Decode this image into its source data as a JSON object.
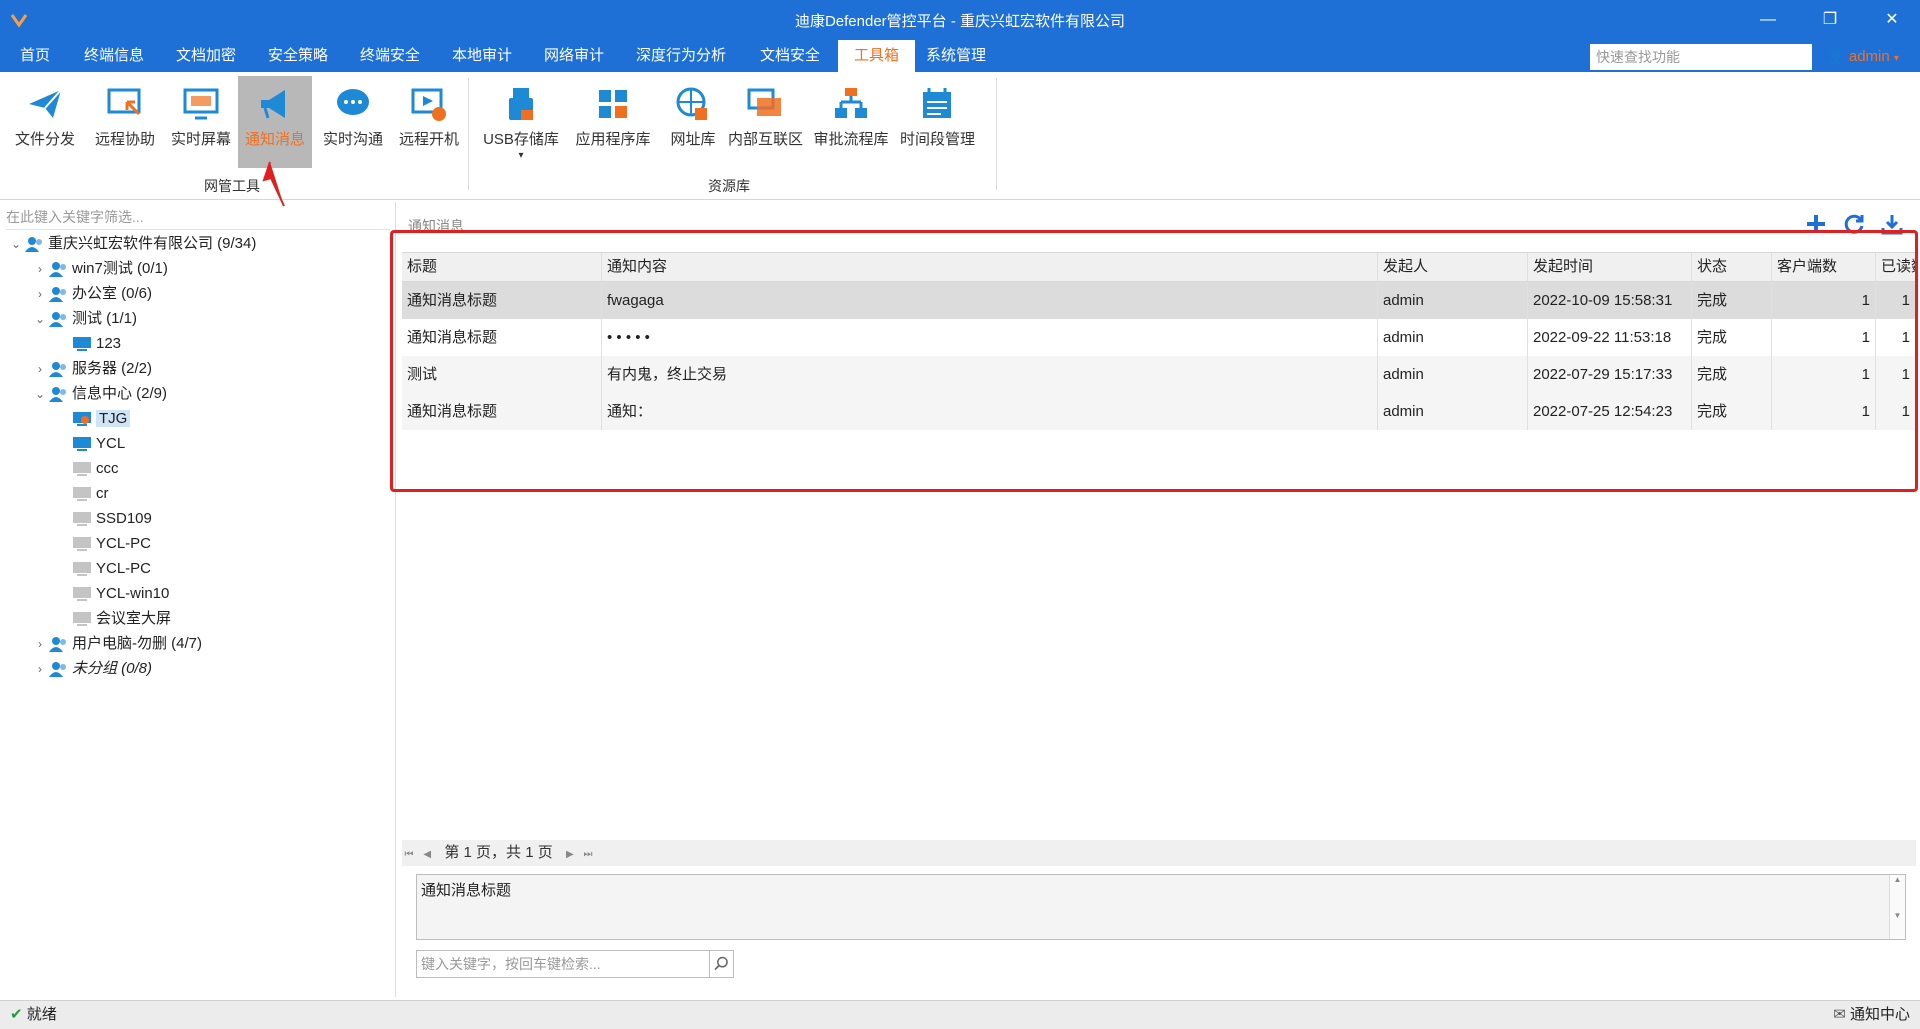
{
  "window": {
    "title": "迪康Defender管控平台 - 重庆兴虹宏软件有限公司"
  },
  "menu": {
    "items": [
      {
        "label": "首页"
      },
      {
        "label": "终端信息"
      },
      {
        "label": "文档加密"
      },
      {
        "label": "安全策略"
      },
      {
        "label": "终端安全"
      },
      {
        "label": "本地审计"
      },
      {
        "label": "网络审计"
      },
      {
        "label": "深度行为分析"
      },
      {
        "label": "文档安全"
      },
      {
        "label": "工具箱",
        "active": true
      },
      {
        "label": "系统管理"
      }
    ],
    "quick_search_placeholder": "快速查找功能",
    "user": "admin"
  },
  "ribbon": {
    "groups": [
      {
        "label": "网管工具",
        "tools": [
          {
            "label": "文件分发",
            "icon": "paper-plane-icon"
          },
          {
            "label": "远程协助",
            "icon": "remote-assist-icon"
          },
          {
            "label": "实时屏幕",
            "icon": "monitor-icon"
          },
          {
            "label": "通知消息",
            "icon": "megaphone-icon",
            "active": true
          },
          {
            "label": "实时沟通",
            "icon": "chat-bubble-icon"
          },
          {
            "label": "远程开机",
            "icon": "remote-power-icon"
          }
        ]
      },
      {
        "label": "资源库",
        "tools": [
          {
            "label": "USB存储库",
            "icon": "usb-icon",
            "dropdown": "▾"
          },
          {
            "label": "应用程序库",
            "icon": "app-grid-icon"
          },
          {
            "label": "网址库",
            "icon": "globe-icon"
          },
          {
            "label": "内部互联区",
            "icon": "network-icon"
          },
          {
            "label": "审批流程库",
            "icon": "flow-icon"
          },
          {
            "label": "时间段管理",
            "icon": "calendar-icon"
          }
        ]
      }
    ]
  },
  "tree": {
    "filter_placeholder": "在此键入关键字筛选...",
    "nodes": [
      {
        "label": "重庆兴虹宏软件有限公司 (9/34)",
        "level": 0,
        "chev": "⌄",
        "type": "group"
      },
      {
        "label": "win7测试 (0/1)",
        "level": 1,
        "chev": "›",
        "type": "group"
      },
      {
        "label": "办公室 (0/6)",
        "level": 1,
        "chev": "›",
        "type": "group"
      },
      {
        "label": "测试 (1/1)",
        "level": 1,
        "chev": "⌄",
        "type": "group"
      },
      {
        "label": "123",
        "level": 2,
        "chev": "",
        "type": "pc-online"
      },
      {
        "label": "服务器 (2/2)",
        "level": 1,
        "chev": "›",
        "type": "group"
      },
      {
        "label": "信息中心 (2/9)",
        "level": 1,
        "chev": "⌄",
        "type": "group"
      },
      {
        "label": "TJG",
        "level": 2,
        "chev": "",
        "type": "pc-self",
        "selected": true
      },
      {
        "label": "YCL",
        "level": 2,
        "chev": "",
        "type": "pc-online"
      },
      {
        "label": "ccc",
        "level": 2,
        "chev": "",
        "type": "pc-offline"
      },
      {
        "label": "cr",
        "level": 2,
        "chev": "",
        "type": "pc-offline"
      },
      {
        "label": "SSD109",
        "level": 2,
        "chev": "",
        "type": "pc-offline"
      },
      {
        "label": "YCL-PC",
        "level": 2,
        "chev": "",
        "type": "pc-offline"
      },
      {
        "label": "YCL-PC",
        "level": 2,
        "chev": "",
        "type": "pc-offline"
      },
      {
        "label": "YCL-win10",
        "level": 2,
        "chev": "",
        "type": "pc-offline"
      },
      {
        "label": "会议室大屏",
        "level": 2,
        "chev": "",
        "type": "pc-offline"
      },
      {
        "label": "用户电脑-勿删 (4/7)",
        "level": 1,
        "chev": "›",
        "type": "group"
      },
      {
        "label": "未分组 (0/8)",
        "level": 1,
        "chev": "›",
        "type": "group",
        "italic": true
      }
    ]
  },
  "notices": {
    "section_title": "通知消息",
    "columns": [
      "标题",
      "通知内容",
      "发起人",
      "发起时间",
      "状态",
      "客户端数",
      "已读数"
    ],
    "rows": [
      [
        "通知消息标题",
        "fwagaga",
        "admin",
        "2022-10-09 15:58:31",
        "完成",
        "1",
        "1"
      ],
      [
        "通知消息标题",
        "• • • • •",
        "admin",
        "2022-09-22 11:53:18",
        "完成",
        "1",
        "1"
      ],
      [
        "测试",
        "有内鬼，终止交易",
        "admin",
        "2022-07-29 15:17:33",
        "完成",
        "1",
        "1"
      ],
      [
        "通知消息标题",
        "通知：",
        "admin",
        "2022-07-25 12:54:23",
        "完成",
        "1",
        "1"
      ]
    ],
    "pager_text": "第 1 页，共 1 页",
    "detail_text": "通知消息标题",
    "search_placeholder": "键入关键字，按回车键检索..."
  },
  "status": {
    "ready": "就绪",
    "notify_center": "通知中心"
  },
  "colors": {
    "brand_blue": "#1e6fd6",
    "accent_orange": "#f07020",
    "highlight_red": "#e02020"
  }
}
